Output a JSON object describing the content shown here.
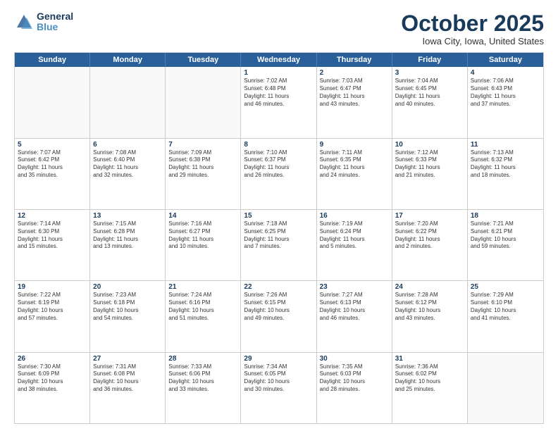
{
  "logo": {
    "general": "General",
    "blue": "Blue"
  },
  "title": {
    "month": "October 2025",
    "location": "Iowa City, Iowa, United States"
  },
  "header": {
    "days": [
      "Sunday",
      "Monday",
      "Tuesday",
      "Wednesday",
      "Thursday",
      "Friday",
      "Saturday"
    ]
  },
  "weeks": [
    [
      {
        "day": "",
        "info": ""
      },
      {
        "day": "",
        "info": ""
      },
      {
        "day": "",
        "info": ""
      },
      {
        "day": "1",
        "info": "Sunrise: 7:02 AM\nSunset: 6:48 PM\nDaylight: 11 hours\nand 46 minutes."
      },
      {
        "day": "2",
        "info": "Sunrise: 7:03 AM\nSunset: 6:47 PM\nDaylight: 11 hours\nand 43 minutes."
      },
      {
        "day": "3",
        "info": "Sunrise: 7:04 AM\nSunset: 6:45 PM\nDaylight: 11 hours\nand 40 minutes."
      },
      {
        "day": "4",
        "info": "Sunrise: 7:06 AM\nSunset: 6:43 PM\nDaylight: 11 hours\nand 37 minutes."
      }
    ],
    [
      {
        "day": "5",
        "info": "Sunrise: 7:07 AM\nSunset: 6:42 PM\nDaylight: 11 hours\nand 35 minutes."
      },
      {
        "day": "6",
        "info": "Sunrise: 7:08 AM\nSunset: 6:40 PM\nDaylight: 11 hours\nand 32 minutes."
      },
      {
        "day": "7",
        "info": "Sunrise: 7:09 AM\nSunset: 6:38 PM\nDaylight: 11 hours\nand 29 minutes."
      },
      {
        "day": "8",
        "info": "Sunrise: 7:10 AM\nSunset: 6:37 PM\nDaylight: 11 hours\nand 26 minutes."
      },
      {
        "day": "9",
        "info": "Sunrise: 7:11 AM\nSunset: 6:35 PM\nDaylight: 11 hours\nand 24 minutes."
      },
      {
        "day": "10",
        "info": "Sunrise: 7:12 AM\nSunset: 6:33 PM\nDaylight: 11 hours\nand 21 minutes."
      },
      {
        "day": "11",
        "info": "Sunrise: 7:13 AM\nSunset: 6:32 PM\nDaylight: 11 hours\nand 18 minutes."
      }
    ],
    [
      {
        "day": "12",
        "info": "Sunrise: 7:14 AM\nSunset: 6:30 PM\nDaylight: 11 hours\nand 15 minutes."
      },
      {
        "day": "13",
        "info": "Sunrise: 7:15 AM\nSunset: 6:28 PM\nDaylight: 11 hours\nand 13 minutes."
      },
      {
        "day": "14",
        "info": "Sunrise: 7:16 AM\nSunset: 6:27 PM\nDaylight: 11 hours\nand 10 minutes."
      },
      {
        "day": "15",
        "info": "Sunrise: 7:18 AM\nSunset: 6:25 PM\nDaylight: 11 hours\nand 7 minutes."
      },
      {
        "day": "16",
        "info": "Sunrise: 7:19 AM\nSunset: 6:24 PM\nDaylight: 11 hours\nand 5 minutes."
      },
      {
        "day": "17",
        "info": "Sunrise: 7:20 AM\nSunset: 6:22 PM\nDaylight: 11 hours\nand 2 minutes."
      },
      {
        "day": "18",
        "info": "Sunrise: 7:21 AM\nSunset: 6:21 PM\nDaylight: 10 hours\nand 59 minutes."
      }
    ],
    [
      {
        "day": "19",
        "info": "Sunrise: 7:22 AM\nSunset: 6:19 PM\nDaylight: 10 hours\nand 57 minutes."
      },
      {
        "day": "20",
        "info": "Sunrise: 7:23 AM\nSunset: 6:18 PM\nDaylight: 10 hours\nand 54 minutes."
      },
      {
        "day": "21",
        "info": "Sunrise: 7:24 AM\nSunset: 6:16 PM\nDaylight: 10 hours\nand 51 minutes."
      },
      {
        "day": "22",
        "info": "Sunrise: 7:26 AM\nSunset: 6:15 PM\nDaylight: 10 hours\nand 49 minutes."
      },
      {
        "day": "23",
        "info": "Sunrise: 7:27 AM\nSunset: 6:13 PM\nDaylight: 10 hours\nand 46 minutes."
      },
      {
        "day": "24",
        "info": "Sunrise: 7:28 AM\nSunset: 6:12 PM\nDaylight: 10 hours\nand 43 minutes."
      },
      {
        "day": "25",
        "info": "Sunrise: 7:29 AM\nSunset: 6:10 PM\nDaylight: 10 hours\nand 41 minutes."
      }
    ],
    [
      {
        "day": "26",
        "info": "Sunrise: 7:30 AM\nSunset: 6:09 PM\nDaylight: 10 hours\nand 38 minutes."
      },
      {
        "day": "27",
        "info": "Sunrise: 7:31 AM\nSunset: 6:08 PM\nDaylight: 10 hours\nand 36 minutes."
      },
      {
        "day": "28",
        "info": "Sunrise: 7:33 AM\nSunset: 6:06 PM\nDaylight: 10 hours\nand 33 minutes."
      },
      {
        "day": "29",
        "info": "Sunrise: 7:34 AM\nSunset: 6:05 PM\nDaylight: 10 hours\nand 30 minutes."
      },
      {
        "day": "30",
        "info": "Sunrise: 7:35 AM\nSunset: 6:03 PM\nDaylight: 10 hours\nand 28 minutes."
      },
      {
        "day": "31",
        "info": "Sunrise: 7:36 AM\nSunset: 6:02 PM\nDaylight: 10 hours\nand 25 minutes."
      },
      {
        "day": "",
        "info": ""
      }
    ]
  ]
}
